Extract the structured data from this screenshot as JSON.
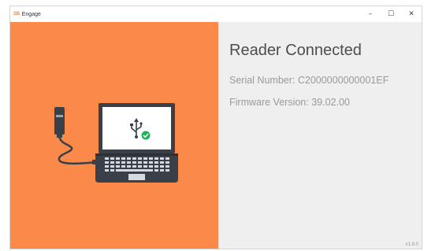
{
  "window": {
    "logo_text": "SB",
    "title": "Engage",
    "controls": {
      "minimize": "–",
      "maximize": "☐",
      "close": "✕"
    }
  },
  "status": {
    "title": "Reader Connected",
    "serial_label": "Serial Number: C2000000000001EF",
    "firmware_label": "Firmware Version: 39.02.00"
  },
  "footer": {
    "version": "v1.8.0"
  },
  "colors": {
    "accent_orange": "#fb8a4a",
    "panel_gray": "#efefef",
    "laptop_dark": "#3a4047",
    "success_green": "#1fb25a"
  },
  "icons": [
    "usb-reader-icon",
    "laptop-icon",
    "usb-icon",
    "check-icon"
  ]
}
